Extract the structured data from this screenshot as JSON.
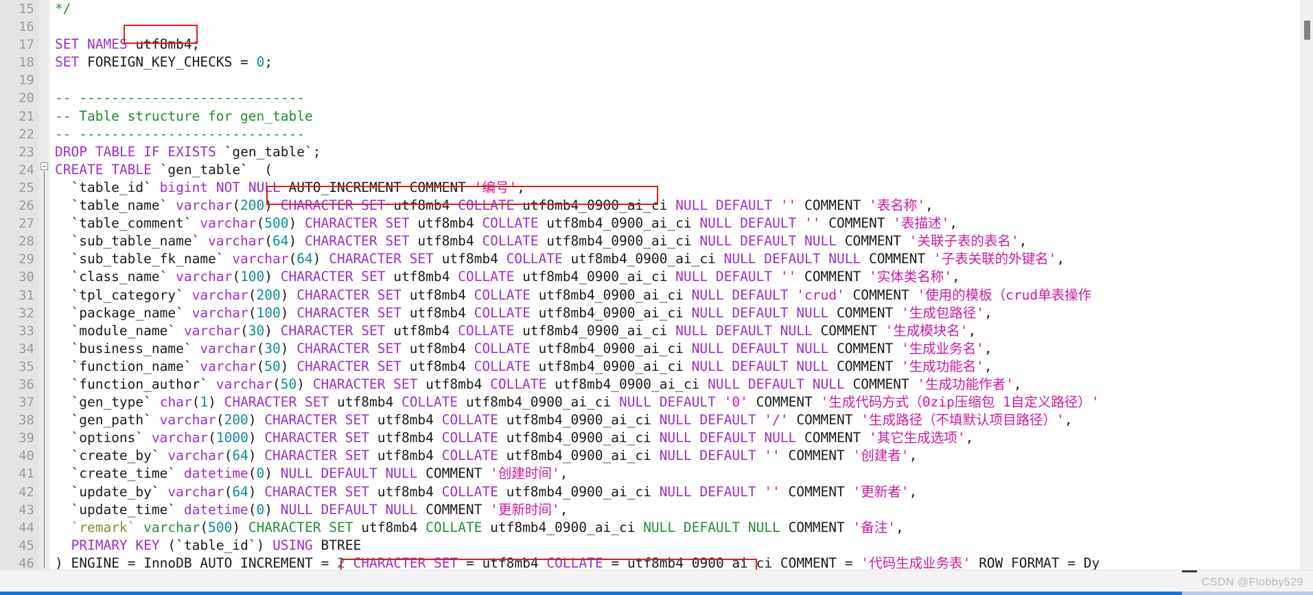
{
  "editor": {
    "first_visible_line": 15,
    "last_visible_line": 46,
    "language": "SQL",
    "watermark": "CSDN @Flobby529",
    "highlight_color": "#e01b1b",
    "gutter_bg": "#e4e4e4",
    "gutter_fg": "#9a9a9a",
    "background": "#ffffff",
    "scrollbar_thumb_color": "#808080",
    "hscroll_color": "#1876d2"
  },
  "line_numbers": [
    15,
    16,
    17,
    18,
    19,
    20,
    21,
    22,
    23,
    24,
    25,
    26,
    27,
    28,
    29,
    30,
    31,
    32,
    33,
    34,
    35,
    36,
    37,
    38,
    39,
    40,
    41,
    42,
    43,
    44,
    45,
    46
  ],
  "lines": [
    {
      "n": 15,
      "text": "*/"
    },
    {
      "n": 16,
      "text": ""
    },
    {
      "n": 17,
      "text": "SET NAMES utf8mb4;"
    },
    {
      "n": 18,
      "text": "SET FOREIGN_KEY_CHECKS = 0;"
    },
    {
      "n": 19,
      "text": ""
    },
    {
      "n": 20,
      "text": "-- ----------------------------"
    },
    {
      "n": 21,
      "text": "-- Table structure for gen_table"
    },
    {
      "n": 22,
      "text": "-- ----------------------------"
    },
    {
      "n": 23,
      "text": "DROP TABLE IF EXISTS `gen_table`;"
    },
    {
      "n": 24,
      "text": "CREATE TABLE `gen_table`  ("
    },
    {
      "n": 25,
      "text": "  `table_id` bigint NOT NULL AUTO_INCREMENT COMMENT '编号',"
    },
    {
      "n": 26,
      "text": "  `table_name` varchar(200) CHARACTER SET utf8mb4 COLLATE utf8mb4_0900_ai_ci NULL DEFAULT '' COMMENT '表名称',"
    },
    {
      "n": 27,
      "text": "  `table_comment` varchar(500) CHARACTER SET utf8mb4 COLLATE utf8mb4_0900_ai_ci NULL DEFAULT '' COMMENT '表描述',"
    },
    {
      "n": 28,
      "text": "  `sub_table_name` varchar(64) CHARACTER SET utf8mb4 COLLATE utf8mb4_0900_ai_ci NULL DEFAULT NULL COMMENT '关联子表的表名',"
    },
    {
      "n": 29,
      "text": "  `sub_table_fk_name` varchar(64) CHARACTER SET utf8mb4 COLLATE utf8mb4_0900_ai_ci NULL DEFAULT NULL COMMENT '子表关联的外键名',"
    },
    {
      "n": 30,
      "text": "  `class_name` varchar(100) CHARACTER SET utf8mb4 COLLATE utf8mb4_0900_ai_ci NULL DEFAULT '' COMMENT '实体类名称',"
    },
    {
      "n": 31,
      "text": "  `tpl_category` varchar(200) CHARACTER SET utf8mb4 COLLATE utf8mb4_0900_ai_ci NULL DEFAULT 'crud' COMMENT '使用的模板（crud单表操作"
    },
    {
      "n": 32,
      "text": "  `package_name` varchar(100) CHARACTER SET utf8mb4 COLLATE utf8mb4_0900_ai_ci NULL DEFAULT NULL COMMENT '生成包路径',"
    },
    {
      "n": 33,
      "text": "  `module_name` varchar(30) CHARACTER SET utf8mb4 COLLATE utf8mb4_0900_ai_ci NULL DEFAULT NULL COMMENT '生成模块名',"
    },
    {
      "n": 34,
      "text": "  `business_name` varchar(30) CHARACTER SET utf8mb4 COLLATE utf8mb4_0900_ai_ci NULL DEFAULT NULL COMMENT '生成业务名',"
    },
    {
      "n": 35,
      "text": "  `function_name` varchar(50) CHARACTER SET utf8mb4 COLLATE utf8mb4_0900_ai_ci NULL DEFAULT NULL COMMENT '生成功能名',"
    },
    {
      "n": 36,
      "text": "  `function_author` varchar(50) CHARACTER SET utf8mb4 COLLATE utf8mb4_0900_ai_ci NULL DEFAULT NULL COMMENT '生成功能作者',"
    },
    {
      "n": 37,
      "text": "  `gen_type` char(1) CHARACTER SET utf8mb4 COLLATE utf8mb4_0900_ai_ci NULL DEFAULT '0' COMMENT '生成代码方式（0zip压缩包 1自定义路径）'"
    },
    {
      "n": 38,
      "text": "  `gen_path` varchar(200) CHARACTER SET utf8mb4 COLLATE utf8mb4_0900_ai_ci NULL DEFAULT '/' COMMENT '生成路径（不填默认项目路径）',"
    },
    {
      "n": 39,
      "text": "  `options` varchar(1000) CHARACTER SET utf8mb4 COLLATE utf8mb4_0900_ai_ci NULL DEFAULT NULL COMMENT '其它生成选项',"
    },
    {
      "n": 40,
      "text": "  `create_by` varchar(64) CHARACTER SET utf8mb4 COLLATE utf8mb4_0900_ai_ci NULL DEFAULT '' COMMENT '创建者',"
    },
    {
      "n": 41,
      "text": "  `create_time` datetime(0) NULL DEFAULT NULL COMMENT '创建时间',"
    },
    {
      "n": 42,
      "text": "  `update_by` varchar(64) CHARACTER SET utf8mb4 COLLATE utf8mb4_0900_ai_ci NULL DEFAULT '' COMMENT '更新者',"
    },
    {
      "n": 43,
      "text": "  `update_time` datetime(0) NULL DEFAULT NULL COMMENT '更新时间',"
    },
    {
      "n": 44,
      "text": "  `remark` varchar(500) CHARACTER SET utf8mb4 COLLATE utf8mb4_0900_ai_ci NULL DEFAULT NULL COMMENT '备注',"
    },
    {
      "n": 45,
      "text": "  PRIMARY KEY (`table_id`) USING BTREE"
    },
    {
      "n": 46,
      "text": ") ENGINE = InnoDB AUTO_INCREMENT = 2 CHARACTER SET = utf8mb4 COLLATE = utf8mb4_0900_ai_ci COMMENT = '代码生成业务表' ROW_FORMAT = Dy"
    }
  ],
  "highlights": [
    {
      "name": "charset-declaration-box",
      "target_line": 17,
      "text": "utf8mb4;"
    },
    {
      "name": "column-charset-collate-box",
      "target_line": 26,
      "text": "CHARACTER SET utf8mb4 COLLATE utf8mb4_0900_ai_ci"
    },
    {
      "name": "table-charset-collate-box",
      "target_line": 46,
      "text": "CHARACTER SET = utf8mb4 COLLATE = utf8mb4_0900_ai_ci"
    }
  ],
  "tokens": {
    "line15": [
      {
        "t": "*/",
        "c": "cmt"
      }
    ],
    "line17": [
      {
        "t": "SET",
        "c": "kw"
      },
      {
        "t": " ",
        "c": "plain"
      },
      {
        "t": "NAMES",
        "c": "kw"
      },
      {
        "t": " utf8mb4;",
        "c": "plain"
      }
    ],
    "line18": [
      {
        "t": "SET",
        "c": "kw"
      },
      {
        "t": " FOREIGN_KEY_CHECKS = ",
        "c": "plain"
      },
      {
        "t": "0",
        "c": "num"
      },
      {
        "t": ";",
        "c": "plain"
      }
    ]
  }
}
